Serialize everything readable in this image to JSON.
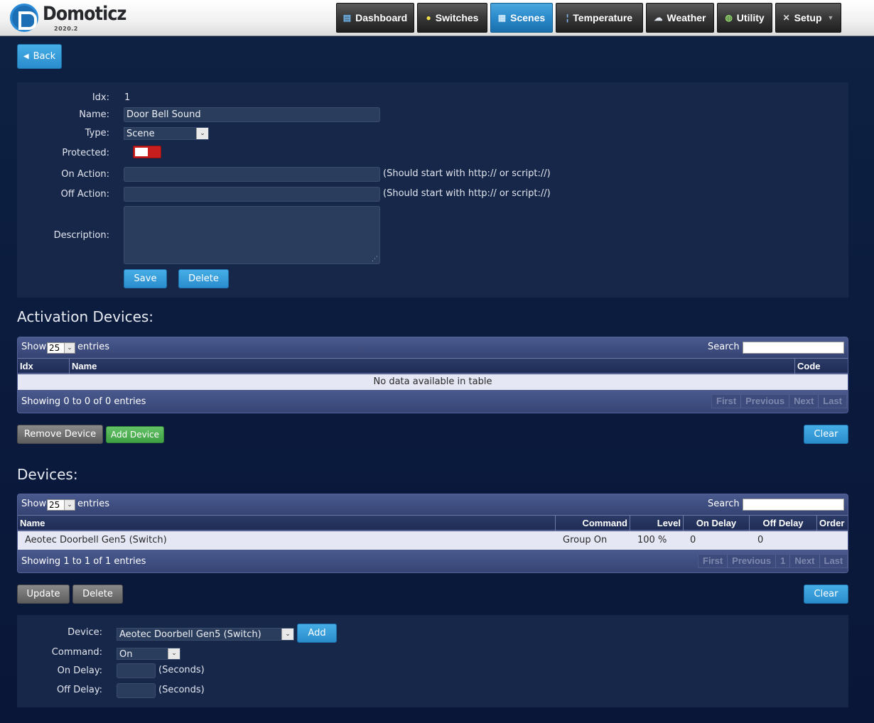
{
  "brand": {
    "name": "Domoticz",
    "version": "2020.2"
  },
  "nav": [
    {
      "label": "Dashboard",
      "icon": "dashboard-icon",
      "glyph": "▤"
    },
    {
      "label": "Switches",
      "icon": "lightbulb-icon",
      "glyph": "●"
    },
    {
      "label": "Scenes",
      "icon": "clapperboard-icon",
      "glyph": "▦"
    },
    {
      "label": "Temperature",
      "icon": "thermometer-icon",
      "glyph": "¦"
    },
    {
      "label": "Weather",
      "icon": "cloud-rain-icon",
      "glyph": "☁"
    },
    {
      "label": "Utility",
      "icon": "globe-icon",
      "glyph": "◍"
    },
    {
      "label": "Setup",
      "icon": "tools-icon",
      "glyph": "✕"
    }
  ],
  "back_label": "Back",
  "scene": {
    "idx_label": "Idx:",
    "idx": "1",
    "name_label": "Name:",
    "name": "Door Bell Sound",
    "type_label": "Type:",
    "type": "Scene",
    "protected_label": "Protected:",
    "on_action_label": "On Action:",
    "on_action": "",
    "off_action_label": "Off Action:",
    "off_action": "",
    "action_hint": "(Should start with http:// or script://)",
    "description_label": "Description:",
    "description": "",
    "save_label": "Save",
    "delete_label": "Delete"
  },
  "activation": {
    "title": "Activation Devices:",
    "show": "Show",
    "entries": "entries",
    "length": "25",
    "search_label": "Search :",
    "columns": [
      "Idx",
      "Name",
      "Code"
    ],
    "empty": "No data available in table",
    "info": "Showing 0 to 0 of 0 entries",
    "pager": [
      "First",
      "Previous",
      "Next",
      "Last"
    ],
    "remove_label": "Remove Device",
    "add_label": "Add Device",
    "clear_label": "Clear"
  },
  "devices": {
    "title": "Devices:",
    "show": "Show",
    "entries": "entries",
    "length": "25",
    "search_label": "Search :",
    "columns": [
      "Name",
      "Command",
      "Level",
      "On Delay",
      "Off Delay",
      "Order"
    ],
    "rows": [
      {
        "name": "Aeotec Doorbell Gen5 (Switch)",
        "command": "Group On",
        "level": "100 %",
        "on_delay": "0",
        "off_delay": "0",
        "order": ""
      }
    ],
    "info": "Showing 1 to 1 of 1 entries",
    "pager": [
      "First",
      "Previous",
      "1",
      "Next",
      "Last"
    ],
    "update_label": "Update",
    "delete_label": "Delete",
    "clear_label": "Clear"
  },
  "add_form": {
    "device_label": "Device:",
    "device": "Aeotec Doorbell Gen5 (Switch)",
    "add_label": "Add",
    "command_label": "Command:",
    "command": "On",
    "on_delay_label": "On Delay:",
    "off_delay_label": "Off Delay:",
    "seconds": "(Seconds)"
  }
}
